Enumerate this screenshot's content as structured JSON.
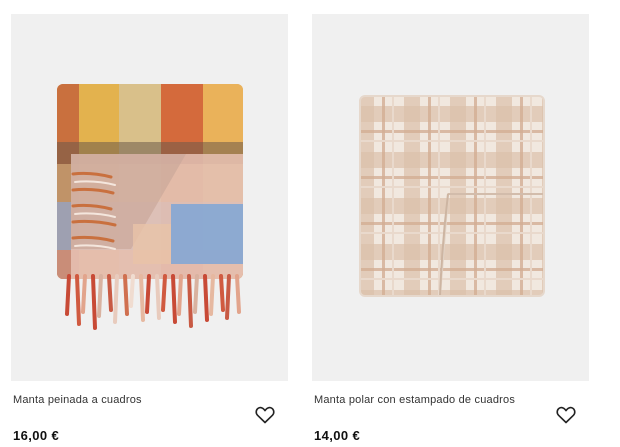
{
  "products": [
    {
      "image_alt": "",
      "name": "Manta peinada a cuadros",
      "price": "16,00 €",
      "favorite_icon": "heart-outline-icon"
    },
    {
      "image_alt": "",
      "name": "Manta polar con estampado de cuadros",
      "price": "14,00 €",
      "favorite_icon": "heart-outline-icon"
    }
  ],
  "colors": {
    "image_background": "#f0f0f0",
    "text": "#333333",
    "price": "#111111"
  }
}
